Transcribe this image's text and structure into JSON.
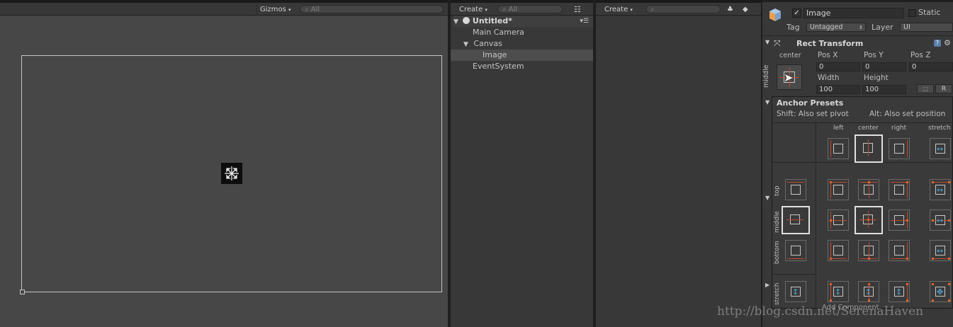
{
  "scene": {
    "gizmos_label": "Gizmos",
    "search_placeholder": "All"
  },
  "hierarchy": {
    "create_label": "Create",
    "search_placeholder": "All",
    "scene_name": "Untitled*",
    "items": [
      {
        "label": "Main Camera"
      },
      {
        "label": "Canvas"
      },
      {
        "label": "Image"
      },
      {
        "label": "EventSystem"
      }
    ]
  },
  "project": {
    "create_label": "Create"
  },
  "inspector": {
    "object_name": "Image",
    "static_label": "Static",
    "tag_label": "Tag",
    "tag_value": "Untagged",
    "layer_label": "Layer",
    "layer_value": "UI",
    "rect_transform_title": "Rect Transform",
    "anchor_h_label": "center",
    "anchor_v_label": "middle",
    "pos_x_label": "Pos X",
    "pos_y_label": "Pos Y",
    "pos_z_label": "Pos Z",
    "pos_x": "0",
    "pos_y": "0",
    "pos_z": "0",
    "width_label": "Width",
    "height_label": "Height",
    "width": "100",
    "height": "100",
    "r_button": "R",
    "add_component": "Add Component"
  },
  "anchor_presets": {
    "title": "Anchor Presets",
    "shift_hint": "Shift: Also set pivot",
    "alt_hint": "Alt: Also set position",
    "columns": [
      "left",
      "center",
      "right",
      "stretch"
    ],
    "rows": [
      "top",
      "middle",
      "bottom",
      "stretch"
    ]
  },
  "watermark": "http://blog.csdn.net/SerenaHaven",
  "colors": {
    "scene_bg": "#474747",
    "panel_bg": "#383838",
    "selected_row": "#4d4d4d",
    "anchor_red": "#c04a2c",
    "anchor_blue": "#4da6d6"
  }
}
